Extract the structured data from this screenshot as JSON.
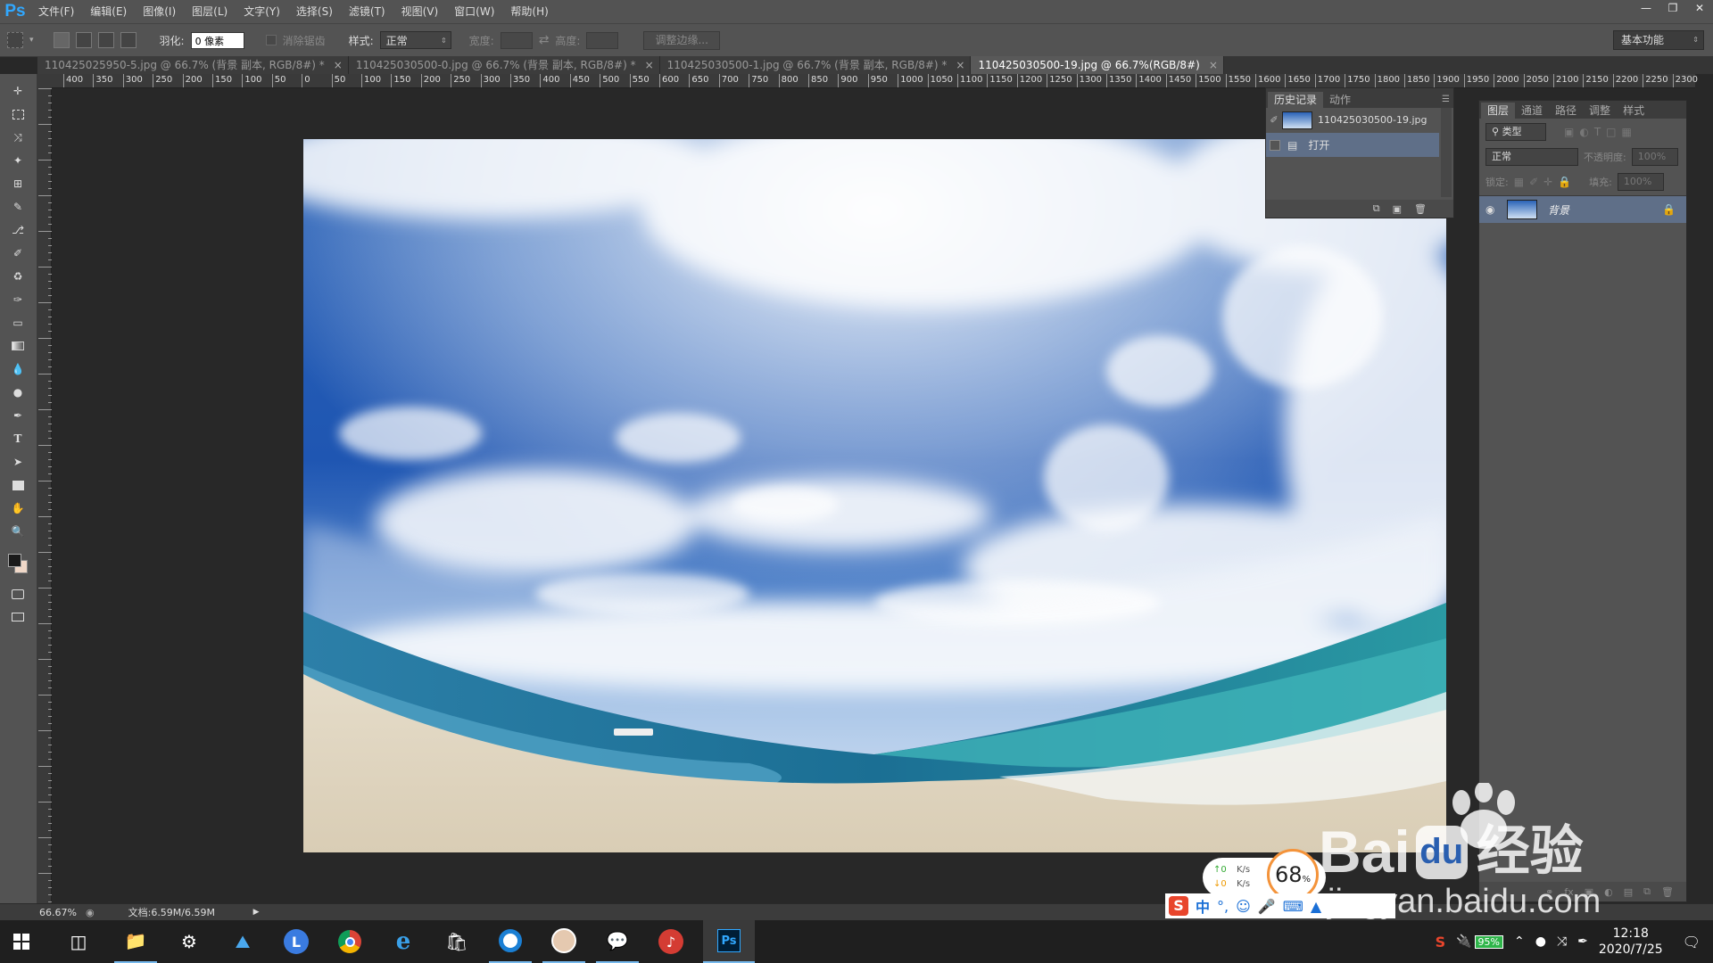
{
  "app": {
    "logo": "Ps"
  },
  "menu": [
    "文件(F)",
    "编辑(E)",
    "图像(I)",
    "图层(L)",
    "文字(Y)",
    "选择(S)",
    "滤镜(T)",
    "视图(V)",
    "窗口(W)",
    "帮助(H)"
  ],
  "options": {
    "feather_label": "羽化:",
    "feather_value": "0 像素",
    "antialias_label": "消除锯齿",
    "style_label": "样式:",
    "style_value": "正常",
    "width_label": "宽度:",
    "height_label": "高度:",
    "refine_edge": "调整边缘...",
    "workspace": "基本功能"
  },
  "tabs": [
    {
      "label": "110425025950-5.jpg @ 66.7% (背景 副本, RGB/8#) *",
      "active": false
    },
    {
      "label": "110425030500-0.jpg @ 66.7% (背景 副本, RGB/8#) *",
      "active": false
    },
    {
      "label": "110425030500-1.jpg @ 66.7% (背景 副本, RGB/8#) *",
      "active": false
    },
    {
      "label": "110425030500-19.jpg @ 66.7%(RGB/8#)",
      "active": true
    }
  ],
  "ruler_top": [
    "400",
    "350",
    "300",
    "250",
    "200",
    "150",
    "100",
    "50",
    "0",
    "50",
    "100",
    "150",
    "200",
    "250",
    "300",
    "350",
    "400",
    "450",
    "500",
    "550",
    "600",
    "650",
    "700",
    "750",
    "800",
    "850",
    "900",
    "950",
    "1000",
    "1050",
    "1100",
    "1150",
    "1200",
    "1250",
    "1300",
    "1350",
    "1400",
    "1450",
    "1500",
    "1550",
    "1600",
    "1650",
    "1700",
    "1750",
    "1800",
    "1850",
    "1900",
    "1950",
    "2000",
    "2050",
    "2100",
    "2150",
    "2200",
    "2250",
    "2300"
  ],
  "history": {
    "tabs": [
      "历史记录",
      "动作"
    ],
    "snapshot": "110425030500-19.jpg",
    "steps": [
      "打开"
    ]
  },
  "layers": {
    "tabs": [
      "图层",
      "通道",
      "路径",
      "调整",
      "样式"
    ],
    "filter": "类型",
    "blend_mode": "正常",
    "opacity_label": "不透明度:",
    "opacity_value": "100%",
    "lock_label": "锁定:",
    "fill_label": "填充:",
    "fill_value": "100%",
    "items": [
      {
        "name": "背景",
        "locked": true
      }
    ]
  },
  "status": {
    "zoom": "66.67%",
    "doc": "文档:6.59M/6.59M"
  },
  "overlay": {
    "cpu_value": "68",
    "cpu_unit": "%",
    "net_up": "0",
    "net_down": "0",
    "net_unit": "K/s",
    "ime_mode": "中"
  },
  "watermark": {
    "brand": "Bai",
    "brand2": "经验",
    "url": "jingyan.baidu.com"
  },
  "taskbar": {
    "battery": "95%",
    "time": "12:18",
    "date": "2020/7/25"
  },
  "colors": {
    "ps_blue": "#31a8ff",
    "panel": "#535353",
    "canvas": "#282828"
  }
}
